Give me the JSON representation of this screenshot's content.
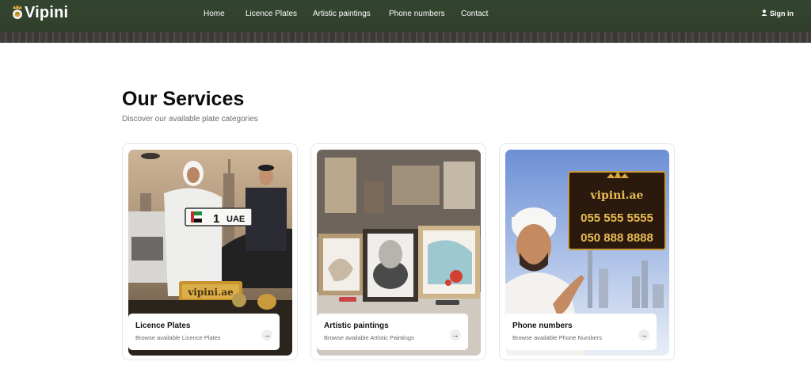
{
  "brand": {
    "name": "Vipini"
  },
  "nav": {
    "items": [
      {
        "label": "Home"
      },
      {
        "label": "Licence Plates"
      },
      {
        "label": "Artistic paintings"
      },
      {
        "label": "Phone numbers"
      },
      {
        "label": "Contact"
      }
    ],
    "signin": "Sign in"
  },
  "services": {
    "title": "Our Services",
    "subtitle": "Discover our available plate categories",
    "cards": [
      {
        "title": "Licence Plates",
        "desc": "Browse available Licence Plates",
        "plate_number": "1",
        "plate_country": "UAE",
        "sign": "vipini.ae"
      },
      {
        "title": "Artistic paintings",
        "desc": "Browse available Artistic Paintings"
      },
      {
        "title": "Phone numbers",
        "desc": "Browse available Phone Numbers",
        "board_site": "vipini.ae",
        "board_numbers": [
          "055 555 5555",
          "050 888 8888"
        ]
      }
    ]
  },
  "colors": {
    "header": "#34452f",
    "gold": "#d4a535",
    "text": "#111111"
  }
}
